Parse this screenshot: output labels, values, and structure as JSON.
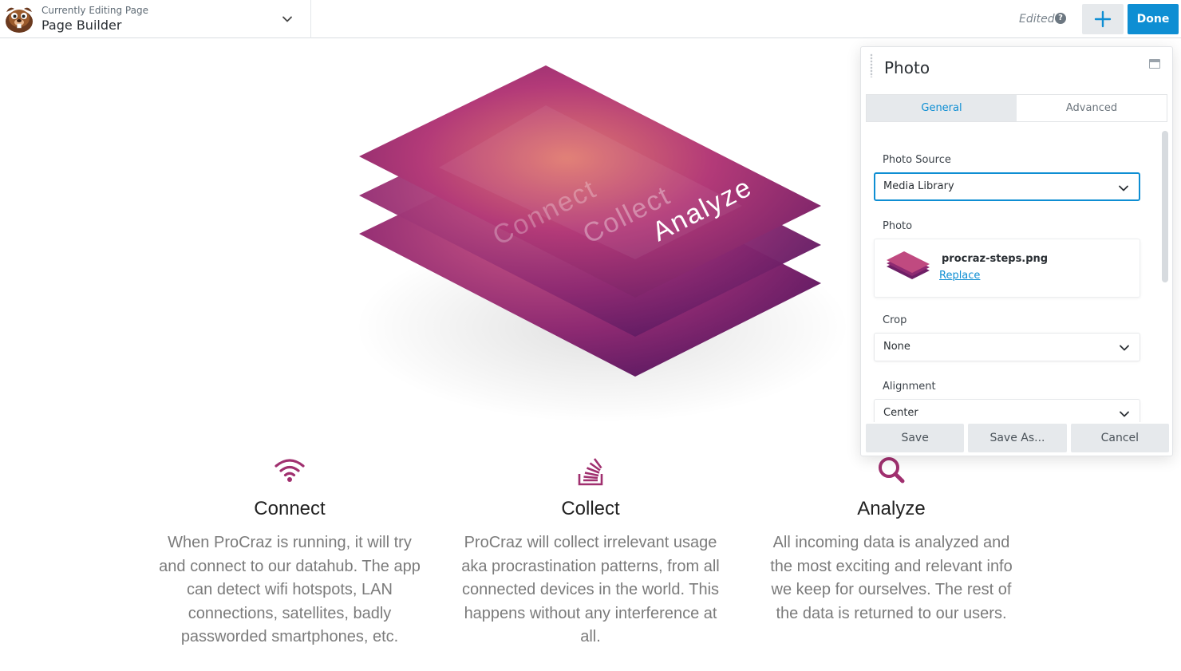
{
  "topbar": {
    "subtitle": "Currently Editing Page",
    "title": "Page Builder",
    "status": "Edited",
    "help_glyph": "?",
    "done_label": "Done",
    "accent": "#0e8ed3"
  },
  "hero": {
    "image_name": "procraz-steps",
    "layer_labels": [
      "Connect",
      "Collect",
      "Analyze"
    ]
  },
  "features": [
    {
      "icon": "wifi-icon",
      "title": "Connect",
      "text": "When ProCraz is running, it will try and connect to our datahub. The app can detect wifi hotspots, LAN connections, satellites, badly passworded smartphones, etc."
    },
    {
      "icon": "stack-icon",
      "title": "Collect",
      "text": "ProCraz will collect irrelevant usage aka procrastination patterns, from all connected devices in the world. This happens without any interference at all."
    },
    {
      "icon": "search-icon",
      "title": "Analyze",
      "text": "All incoming data is analyzed and the most exciting and relevant info we keep for ourselves. The rest of the data is returned to our users."
    }
  ],
  "panel": {
    "title": "Photo",
    "tabs": [
      "General",
      "Advanced"
    ],
    "active_tab": "General",
    "photo_source": {
      "label": "Photo Source",
      "value": "Media Library"
    },
    "photo": {
      "label": "Photo",
      "filename": "procraz-steps.png",
      "replace_label": "Replace"
    },
    "crop": {
      "label": "Crop",
      "value": "None"
    },
    "alignment": {
      "label": "Alignment",
      "value": "Center"
    },
    "buttons": {
      "save": "Save",
      "save_as": "Save As...",
      "cancel": "Cancel"
    }
  },
  "colors": {
    "brand_magenta": "#a0306f",
    "done_blue": "#0e8ed3"
  }
}
